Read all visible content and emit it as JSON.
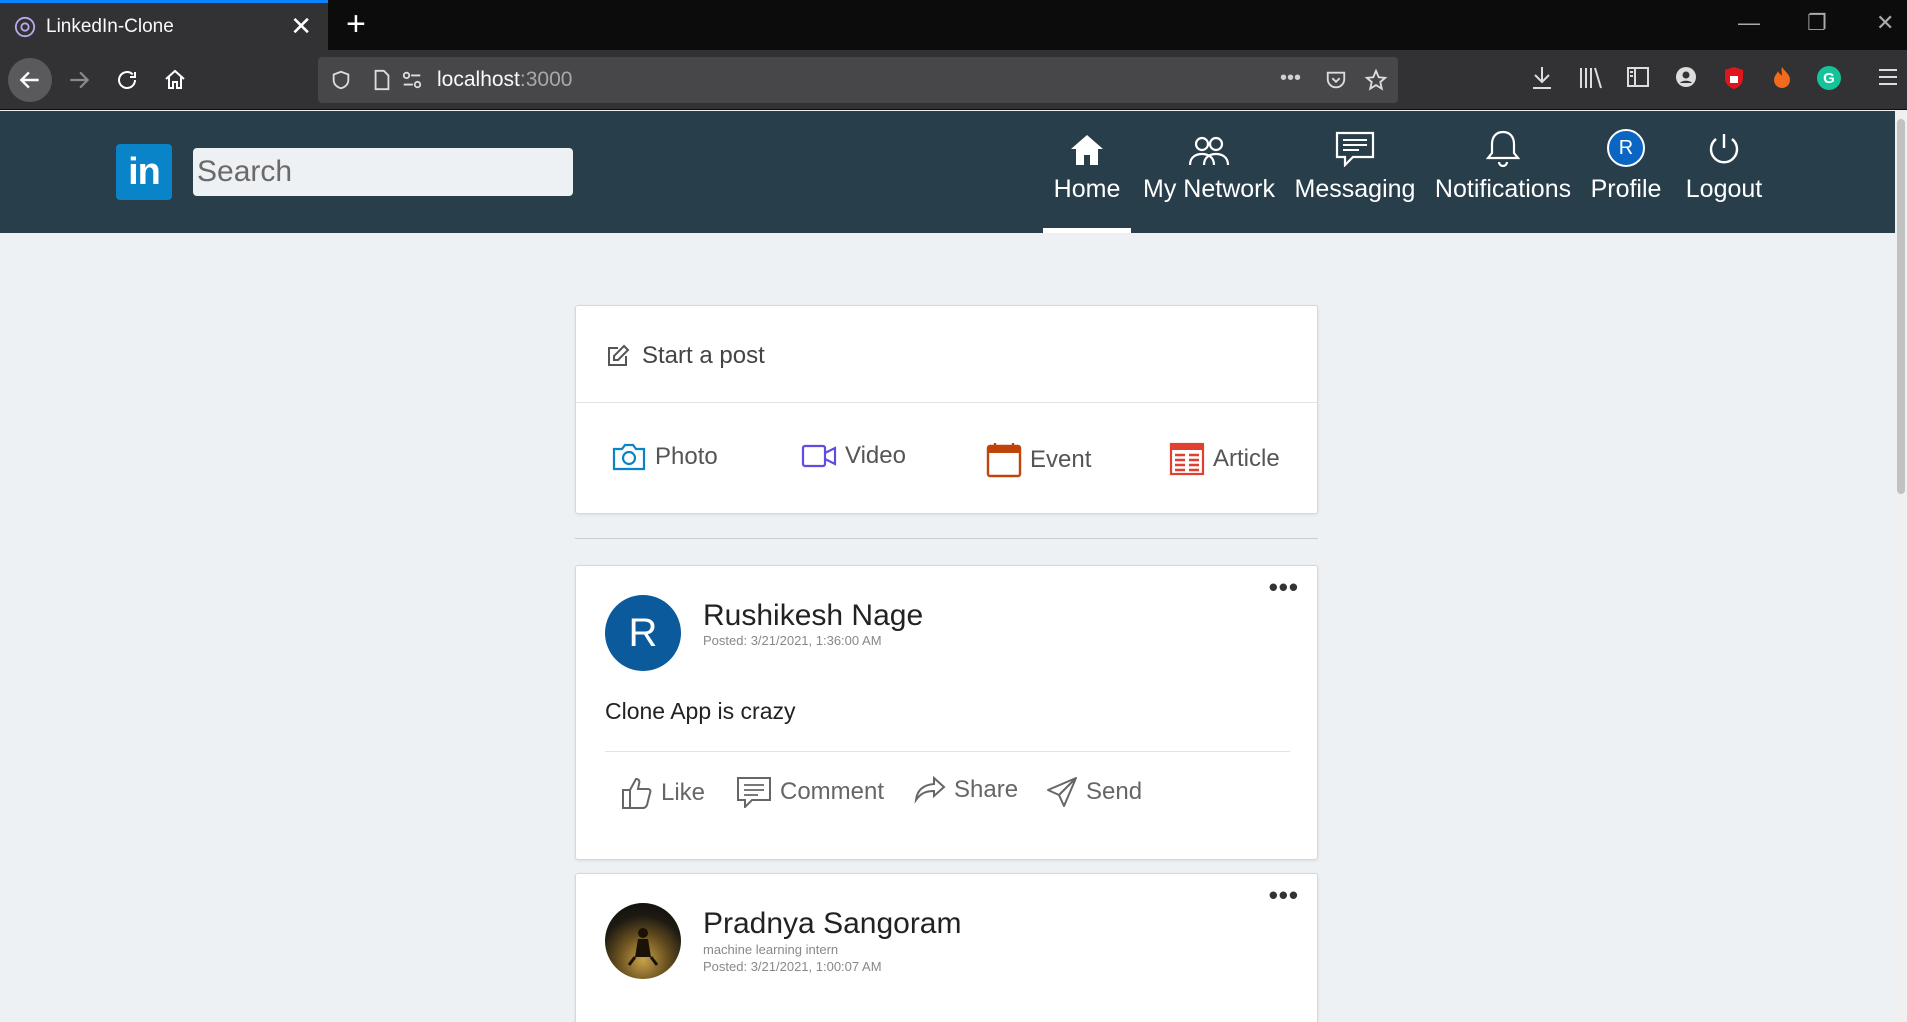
{
  "browser": {
    "tab_title": "LinkedIn-Clone",
    "tab_close": "✕",
    "new_tab": "+",
    "url_host": "localhost",
    "url_port": ":3000",
    "url_dots": "•••"
  },
  "header": {
    "logo": "in",
    "search_placeholder": "Search",
    "nav": [
      {
        "label": "Home",
        "icon": "home-icon",
        "active": true
      },
      {
        "label": "My Network",
        "icon": "network-icon"
      },
      {
        "label": "Messaging",
        "icon": "messaging-icon"
      },
      {
        "label": "Notifications",
        "icon": "bell-icon"
      },
      {
        "label": "Profile",
        "icon": "avatar",
        "initial": "R"
      },
      {
        "label": "Logout",
        "icon": "power-icon"
      }
    ]
  },
  "composer": {
    "start_post": "Start a post",
    "actions": [
      {
        "label": "Photo",
        "icon": "camera-icon",
        "color": "#0a84c8"
      },
      {
        "label": "Video",
        "icon": "video-icon",
        "color": "#5f4de0"
      },
      {
        "label": "Event",
        "icon": "calendar-icon",
        "color": "#c0440a"
      },
      {
        "label": "Article",
        "icon": "article-icon",
        "color": "#e0402f"
      }
    ]
  },
  "posts": [
    {
      "author": "Rushikesh Nage",
      "initial": "R",
      "posted": "Posted: 3/21/2021, 1:36:00 AM",
      "text": "Clone App is crazy",
      "more": "•••"
    },
    {
      "author": "Pradnya Sangoram",
      "headline": "machine learning intern",
      "posted": "Posted: 3/21/2021, 1:00:07 AM",
      "more": "•••"
    }
  ],
  "post_actions": [
    "Like",
    "Comment",
    "Share",
    "Send"
  ]
}
